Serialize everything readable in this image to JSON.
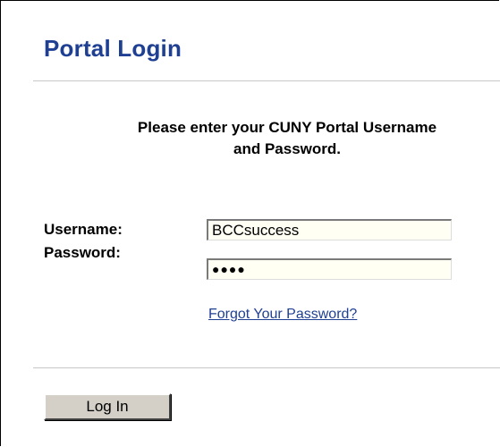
{
  "header": {
    "title": "Portal Login"
  },
  "instruction": {
    "line1": "Please enter your CUNY Portal Username",
    "line2": "and Password."
  },
  "form": {
    "username_label": "Username:",
    "username_value": "BCCsuccess",
    "password_label": "Password:",
    "password_value": "●●●●",
    "forgot_link": "Forgot Your Password?",
    "login_button": "Log In"
  },
  "colors": {
    "title": "#1f3f92",
    "link": "#1f3f92",
    "input_background": "#fffff4",
    "button_face": "#d4d0c8",
    "divider": "#c8c8c8"
  }
}
